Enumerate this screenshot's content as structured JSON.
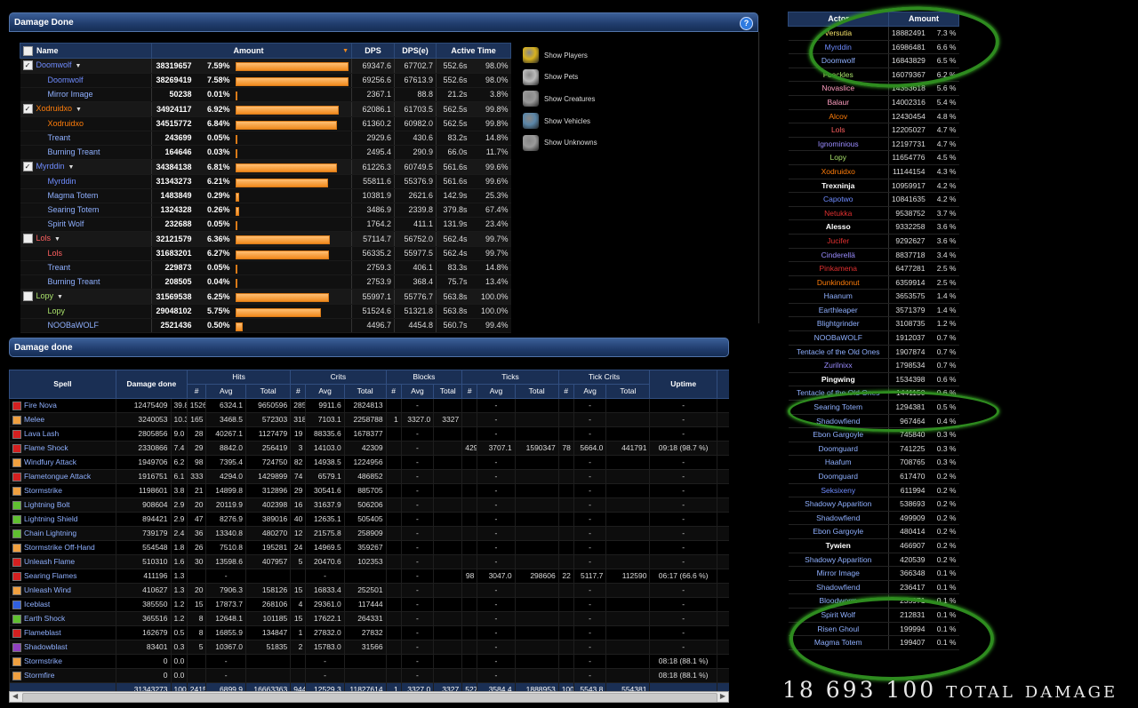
{
  "panel1": {
    "title": "Damage Done",
    "help": "?"
  },
  "t1": {
    "headers": [
      "Name",
      "Amount",
      "DPS",
      "DPS(e)",
      "Active Time"
    ],
    "rows": [
      {
        "name": "Doomwolf",
        "color": "#6f8cff",
        "group": true,
        "check": true,
        "amount": "38319657",
        "pct": "7.59%",
        "bar": 1.0,
        "dps": "69347.6",
        "dpse": "67702.7",
        "at": "552.6s",
        "atp": "98.0%"
      },
      {
        "name": "Doomwolf",
        "color": "#6f8cff",
        "amount": "38269419",
        "pct": "7.58%",
        "bar": 0.999,
        "dps": "69256.6",
        "dpse": "67613.9",
        "at": "552.6s",
        "atp": "98.0%"
      },
      {
        "name": "Mirror Image",
        "color": "#8fb0ff",
        "amount": "50238",
        "pct": "0.01%",
        "bar": 0.0013,
        "dps": "2367.1",
        "dpse": "88.8",
        "at": "21.2s",
        "atp": "3.8%"
      },
      {
        "name": "Xodruidxo",
        "color": "#ff7d0a",
        "group": true,
        "check": true,
        "amount": "34924117",
        "pct": "6.92%",
        "bar": 0.911,
        "dps": "62086.1",
        "dpse": "61703.5",
        "at": "562.5s",
        "atp": "99.8%"
      },
      {
        "name": "Xodruidxo",
        "color": "#ff7d0a",
        "amount": "34515772",
        "pct": "6.84%",
        "bar": 0.9,
        "dps": "61360.2",
        "dpse": "60982.0",
        "at": "562.5s",
        "atp": "99.8%"
      },
      {
        "name": "Treant",
        "color": "#8fb0ff",
        "amount": "243699",
        "pct": "0.05%",
        "bar": 0.0064,
        "dps": "2929.6",
        "dpse": "430.6",
        "at": "83.2s",
        "atp": "14.8%"
      },
      {
        "name": "Burning Treant",
        "color": "#8fb0ff",
        "amount": "164646",
        "pct": "0.03%",
        "bar": 0.0043,
        "dps": "2495.4",
        "dpse": "290.9",
        "at": "66.0s",
        "atp": "11.7%"
      },
      {
        "name": "Myrddin",
        "color": "#6f8cff",
        "group": true,
        "check": true,
        "amount": "34384138",
        "pct": "6.81%",
        "bar": 0.897,
        "dps": "61226.3",
        "dpse": "60749.5",
        "at": "561.6s",
        "atp": "99.6%"
      },
      {
        "name": "Myrddin",
        "color": "#6f8cff",
        "amount": "31343273",
        "pct": "6.21%",
        "bar": 0.818,
        "dps": "55811.6",
        "dpse": "55376.9",
        "at": "561.6s",
        "atp": "99.6%"
      },
      {
        "name": "Magma Totem",
        "color": "#8fb0ff",
        "amount": "1483849",
        "pct": "0.29%",
        "bar": 0.0387,
        "dps": "10381.9",
        "dpse": "2621.6",
        "at": "142.9s",
        "atp": "25.3%"
      },
      {
        "name": "Searing Totem",
        "color": "#8fb0ff",
        "amount": "1324328",
        "pct": "0.26%",
        "bar": 0.0346,
        "dps": "3486.9",
        "dpse": "2339.8",
        "at": "379.8s",
        "atp": "67.4%"
      },
      {
        "name": "Spirit Wolf",
        "color": "#8fb0ff",
        "amount": "232688",
        "pct": "0.05%",
        "bar": 0.0061,
        "dps": "1764.2",
        "dpse": "411.1",
        "at": "131.9s",
        "atp": "23.4%"
      },
      {
        "name": "Lols",
        "color": "#ff6060",
        "group": true,
        "check": false,
        "amount": "32121579",
        "pct": "6.36%",
        "bar": 0.838,
        "dps": "57114.7",
        "dpse": "56752.0",
        "at": "562.4s",
        "atp": "99.7%"
      },
      {
        "name": "Lols",
        "color": "#ff6060",
        "amount": "31683201",
        "pct": "6.27%",
        "bar": 0.827,
        "dps": "56335.2",
        "dpse": "55977.5",
        "at": "562.4s",
        "atp": "99.7%"
      },
      {
        "name": "Treant",
        "color": "#8fb0ff",
        "amount": "229873",
        "pct": "0.05%",
        "bar": 0.006,
        "dps": "2759.3",
        "dpse": "406.1",
        "at": "83.3s",
        "atp": "14.8%"
      },
      {
        "name": "Burning Treant",
        "color": "#8fb0ff",
        "amount": "208505",
        "pct": "0.04%",
        "bar": 0.0054,
        "dps": "2753.9",
        "dpse": "368.4",
        "at": "75.7s",
        "atp": "13.4%"
      },
      {
        "name": "Lopy",
        "color": "#a8e06a",
        "group": true,
        "check": false,
        "amount": "31569538",
        "pct": "6.25%",
        "bar": 0.824,
        "dps": "55997.1",
        "dpse": "55776.7",
        "at": "563.8s",
        "atp": "100.0%"
      },
      {
        "name": "Lopy",
        "color": "#a8e06a",
        "amount": "29048102",
        "pct": "5.75%",
        "bar": 0.758,
        "dps": "51524.6",
        "dpse": "51321.8",
        "at": "563.8s",
        "atp": "100.0%"
      },
      {
        "name": "NOOBaWOLF",
        "color": "#8fb0ff",
        "amount": "2521436",
        "pct": "0.50%",
        "bar": 0.0658,
        "dps": "4496.7",
        "dpse": "4454.8",
        "at": "560.7s",
        "atp": "99.4%"
      }
    ]
  },
  "filters": [
    {
      "label": "Show Players",
      "icon": "players-icon",
      "color": "#d8b21e"
    },
    {
      "label": "Show Pets",
      "icon": "pets-icon",
      "color": "#bbbbbb"
    },
    {
      "label": "Show Creatures",
      "icon": "creatures-icon",
      "color": "#999999"
    },
    {
      "label": "Show Vehicles",
      "icon": "vehicles-icon",
      "color": "#5a86a8"
    },
    {
      "label": "Show Unknowns",
      "icon": "unknown-icon",
      "color": "#9a9a9a"
    }
  ],
  "panel2": {
    "title": "Damage done"
  },
  "t2": {
    "groups": [
      "Spell",
      "Damage done",
      "Hits",
      "Crits",
      "Blocks",
      "Ticks",
      "Tick Crits",
      "Uptime"
    ],
    "sub": {
      "count": "#",
      "avg": "Avg",
      "total": "Total"
    },
    "rows": [
      {
        "c": "#d42020",
        "n": "Fire Nova",
        "v": [
          "12475409",
          "39.8 %",
          "1526",
          "6324.1",
          "9650596",
          "285",
          "9911.6",
          "2824813",
          "",
          "-",
          "",
          "",
          "-",
          "",
          "",
          "-",
          "",
          "-",
          ""
        ]
      },
      {
        "c": "#f0a040",
        "n": "Melee",
        "v": [
          "3240053",
          "10.3 %",
          "165",
          "3468.5",
          "572303",
          "318",
          "7103.1",
          "2258788",
          "1",
          "3327.0",
          "3327",
          "",
          "-",
          "",
          "",
          "-",
          "",
          "-",
          "157"
        ]
      },
      {
        "c": "#d42020",
        "n": "Lava Lash",
        "v": [
          "2805856",
          "9.0 %",
          "28",
          "40267.1",
          "1127479",
          "19",
          "88335.6",
          "1678377",
          "",
          "-",
          "",
          "",
          "-",
          "",
          "",
          "-",
          "",
          "-",
          ""
        ]
      },
      {
        "c": "#d42020",
        "n": "Flame Shock",
        "v": [
          "2330866",
          "7.4 %",
          "29",
          "8842.0",
          "256419",
          "3",
          "14103.0",
          "42309",
          "",
          "-",
          "",
          "429",
          "3707.1",
          "1590347",
          "78",
          "5664.0",
          "441791",
          "09:18 (98.7 %)",
          ""
        ]
      },
      {
        "c": "#f0a040",
        "n": "Windfury Attack",
        "v": [
          "1949706",
          "6.2 %",
          "98",
          "7395.4",
          "724750",
          "82",
          "14938.5",
          "1224956",
          "",
          "-",
          "",
          "",
          "-",
          "",
          "",
          "-",
          "",
          "-",
          ""
        ]
      },
      {
        "c": "#d42020",
        "n": "Flametongue Attack",
        "v": [
          "1916751",
          "6.1 %",
          "333",
          "4294.0",
          "1429899",
          "74",
          "6579.1",
          "486852",
          "",
          "-",
          "",
          "",
          "-",
          "",
          "",
          "-",
          "",
          "-",
          ""
        ]
      },
      {
        "c": "#f0a040",
        "n": "Stormstrike",
        "v": [
          "1198601",
          "3.8 %",
          "21",
          "14899.8",
          "312896",
          "29",
          "30541.6",
          "885705",
          "",
          "-",
          "",
          "",
          "-",
          "",
          "",
          "-",
          "",
          "-",
          ""
        ]
      },
      {
        "c": "#60c030",
        "n": "Lightning Bolt",
        "v": [
          "908604",
          "2.9 %",
          "20",
          "20119.9",
          "402398",
          "16",
          "31637.9",
          "506206",
          "",
          "-",
          "",
          "",
          "-",
          "",
          "",
          "-",
          "",
          "-",
          ""
        ]
      },
      {
        "c": "#60c030",
        "n": "Lightning Shield",
        "v": [
          "894421",
          "2.9 %",
          "47",
          "8276.9",
          "389016",
          "40",
          "12635.1",
          "505405",
          "",
          "-",
          "",
          "",
          "-",
          "",
          "",
          "-",
          "",
          "-",
          ""
        ]
      },
      {
        "c": "#60c030",
        "n": "Chain Lightning",
        "v": [
          "739179",
          "2.4 %",
          "36",
          "13340.8",
          "480270",
          "12",
          "21575.8",
          "258909",
          "",
          "-",
          "",
          "",
          "-",
          "",
          "",
          "-",
          "",
          "-",
          ""
        ]
      },
      {
        "c": "#f0a040",
        "n": "Stormstrike Off-Hand",
        "v": [
          "554548",
          "1.8 %",
          "26",
          "7510.8",
          "195281",
          "24",
          "14969.5",
          "359267",
          "",
          "-",
          "",
          "",
          "-",
          "",
          "",
          "-",
          "",
          "-",
          ""
        ]
      },
      {
        "c": "#d42020",
        "n": "Unleash Flame",
        "v": [
          "510310",
          "1.6 %",
          "30",
          "13598.6",
          "407957",
          "5",
          "20470.6",
          "102353",
          "",
          "-",
          "",
          "",
          "-",
          "",
          "",
          "-",
          "",
          "-",
          ""
        ]
      },
      {
        "c": "#d42020",
        "n": "Searing Flames",
        "v": [
          "411196",
          "1.3 %",
          "",
          "-",
          "",
          "",
          "-",
          "",
          "",
          "-",
          "",
          "98",
          "3047.0",
          "298606",
          "22",
          "5117.7",
          "112590",
          "06:17 (66.6 %)",
          ""
        ]
      },
      {
        "c": "#f0a040",
        "n": "Unleash Wind",
        "v": [
          "410627",
          "1.3 %",
          "20",
          "7906.3",
          "158126",
          "15",
          "16833.4",
          "252501",
          "",
          "-",
          "",
          "",
          "-",
          "",
          "",
          "-",
          "",
          "-",
          ""
        ]
      },
      {
        "c": "#3060e0",
        "n": "Iceblast",
        "v": [
          "385550",
          "1.2 %",
          "15",
          "17873.7",
          "268106",
          "4",
          "29361.0",
          "117444",
          "",
          "-",
          "",
          "",
          "-",
          "",
          "",
          "-",
          "",
          "-",
          ""
        ]
      },
      {
        "c": "#60c030",
        "n": "Earth Shock",
        "v": [
          "365516",
          "1.2 %",
          "8",
          "12648.1",
          "101185",
          "15",
          "17622.1",
          "264331",
          "",
          "-",
          "",
          "",
          "-",
          "",
          "",
          "-",
          "",
          "-",
          ""
        ]
      },
      {
        "c": "#d42020",
        "n": "Flameblast",
        "v": [
          "162679",
          "0.5 %",
          "8",
          "16855.9",
          "134847",
          "1",
          "27832.0",
          "27832",
          "",
          "-",
          "",
          "",
          "-",
          "",
          "",
          "-",
          "",
          "-",
          ""
        ]
      },
      {
        "c": "#9040c0",
        "n": "Shadowblast",
        "v": [
          "83401",
          "0.3 %",
          "5",
          "10367.0",
          "51835",
          "2",
          "15783.0",
          "31566",
          "",
          "-",
          "",
          "",
          "-",
          "",
          "",
          "-",
          "",
          "-",
          ""
        ]
      },
      {
        "c": "#f0a040",
        "n": "Stormstrike",
        "v": [
          "0",
          "0.0 %",
          "",
          "-",
          "",
          "",
          "-",
          "",
          "",
          "-",
          "",
          "",
          "-",
          "",
          "",
          "-",
          "",
          "08:18 (88.1 %)",
          ""
        ]
      },
      {
        "c": "#f0a040",
        "n": "Stormfire",
        "v": [
          "0",
          "0.0 %",
          "",
          "-",
          "",
          "",
          "-",
          "",
          "",
          "-",
          "",
          "",
          "-",
          "",
          "",
          "-",
          "",
          "08:18 (88.1 %)",
          ""
        ]
      }
    ],
    "total": [
      "31343273",
      "100%",
      "2415",
      "6899.9",
      "16663363",
      "944",
      "12529.3",
      "11827614",
      "1",
      "3327.0",
      "3327",
      "527",
      "3584.4",
      "1888953",
      "100",
      "5543.8",
      "554381",
      "",
      "157"
    ]
  },
  "t3": {
    "headers": [
      "Actor",
      "Amount"
    ],
    "rows": [
      [
        "Versutia",
        "18882491",
        "7.3 %",
        "#f5e26a"
      ],
      [
        "Myrddin",
        "16986481",
        "6.6 %",
        "#6f8cff"
      ],
      [
        "Doomwolf",
        "16843829",
        "6.5 %",
        "#8fb0ff"
      ],
      [
        "Foackles",
        "16079367",
        "6.2 %",
        "#a8e06a"
      ],
      [
        "Novaslice",
        "14353618",
        "5.6 %",
        "#ff9ec0"
      ],
      [
        "Balaur",
        "14002316",
        "5.4 %",
        "#ff9ec0"
      ],
      [
        "Alcov",
        "12430454",
        "4.8 %",
        "#ff7d0a"
      ],
      [
        "Lols",
        "12205027",
        "4.7 %",
        "#ff6060"
      ],
      [
        "Ignominious",
        "12197731",
        "4.7 %",
        "#9a8cff"
      ],
      [
        "Lopy",
        "11654776",
        "4.5 %",
        "#a8e06a"
      ],
      [
        "Xodruidxo",
        "11144154",
        "4.3 %",
        "#ff7d0a"
      ],
      [
        "Trexninja",
        "10959917",
        "4.2 %",
        "#ffffff"
      ],
      [
        "Capotwo",
        "10841635",
        "4.2 %",
        "#6f8cff"
      ],
      [
        "Netukka",
        "9538752",
        "3.7 %",
        "#e03030"
      ],
      [
        "Alesso",
        "9332258",
        "3.6 %",
        "#ffffff"
      ],
      [
        "Jucifer",
        "9292627",
        "3.6 %",
        "#e03030"
      ],
      [
        "Cinderellä",
        "8837718",
        "3.4 %",
        "#9a8cff"
      ],
      [
        "Pinkamena",
        "6477281",
        "2.5 %",
        "#e03030"
      ],
      [
        "Dunkindonut",
        "6359914",
        "2.5 %",
        "#ff7d0a"
      ],
      [
        "Haanum",
        "3653575",
        "1.4 %",
        "#8fb0ff"
      ],
      [
        "Earthleaper",
        "3571379",
        "1.4 %",
        "#8fb0ff"
      ],
      [
        "Blightgrinder",
        "3108735",
        "1.2 %",
        "#8fb0ff"
      ],
      [
        "NOOBaWOLF",
        "1912037",
        "0.7 %",
        "#8fb0ff"
      ],
      [
        "Tentacle of the Old Ones",
        "1907874",
        "0.7 %",
        "#8fb0ff"
      ],
      [
        "Zurilnixx",
        "1798534",
        "0.7 %",
        "#9a8cff"
      ],
      [
        "Pingwing",
        "1534398",
        "0.6 %",
        "#ffffff"
      ],
      [
        "Tentacle of the Old Ones",
        "1441150",
        "0.6 %",
        "#8fb0ff"
      ],
      [
        "Searing Totem",
        "1294381",
        "0.5 %",
        "#8fb0ff"
      ],
      [
        "Shadowfiend",
        "967464",
        "0.4 %",
        "#8fb0ff"
      ],
      [
        "Ebon Gargoyle",
        "745840",
        "0.3 %",
        "#8fb0ff"
      ],
      [
        "Doomguard",
        "741225",
        "0.3 %",
        "#8fb0ff"
      ],
      [
        "Haafum",
        "708765",
        "0.3 %",
        "#8fb0ff"
      ],
      [
        "Doomguard",
        "617470",
        "0.2 %",
        "#8fb0ff"
      ],
      [
        "Seksixeny",
        "611994",
        "0.2 %",
        "#6f8cff"
      ],
      [
        "Shadowy Apparition",
        "538693",
        "0.2 %",
        "#8fb0ff"
      ],
      [
        "Shadowfiend",
        "499909",
        "0.2 %",
        "#8fb0ff"
      ],
      [
        "Ebon Gargoyle",
        "480414",
        "0.2 %",
        "#8fb0ff"
      ],
      [
        "Tywien",
        "466907",
        "0.2 %",
        "#ffffff"
      ],
      [
        "Shadowy Apparition",
        "420539",
        "0.2 %",
        "#8fb0ff"
      ],
      [
        "Mirror Image",
        "366348",
        "0.1 %",
        "#8fb0ff"
      ],
      [
        "Shadowfiend",
        "236417",
        "0.1 %",
        "#8fb0ff"
      ],
      [
        "Bloodworm",
        "235971",
        "0.1 %",
        "#8fb0ff"
      ],
      [
        "Spirit Wolf",
        "212831",
        "0.1 %",
        "#8fb0ff"
      ],
      [
        "Risen Ghoul",
        "199994",
        "0.1 %",
        "#8fb0ff"
      ],
      [
        "Magma Totem",
        "199407",
        "0.1 %",
        "#8fb0ff"
      ]
    ]
  },
  "total_text": "18 693 100 total damage"
}
